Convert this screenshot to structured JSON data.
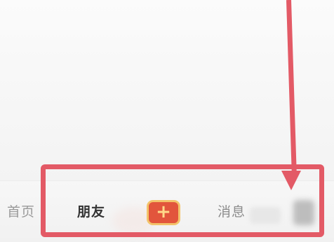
{
  "tabbar": {
    "items": [
      {
        "label": "首页"
      },
      {
        "label": "朋友"
      },
      {
        "label": "+"
      },
      {
        "label": "消息"
      }
    ]
  },
  "colors": {
    "accent_red": "#e2553c",
    "plus_border": "#f3c36a",
    "annotation_red": "#e35a66"
  },
  "icons": {
    "plus": "plus-icon"
  }
}
